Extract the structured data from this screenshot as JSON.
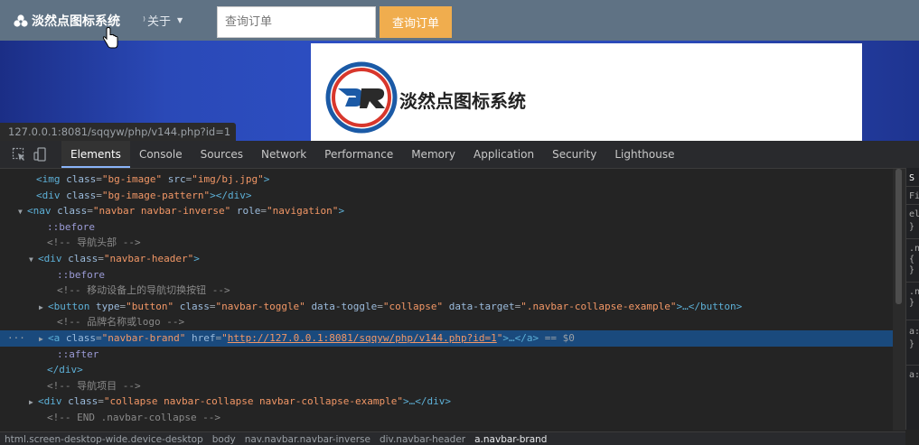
{
  "page": {
    "brand": "淡然点图标系统",
    "about_label": "关于",
    "search_placeholder": "查询订单",
    "search_button": "查询订单",
    "card_title": "淡然点图标系统",
    "status_url": "127.0.0.1:8081/sqqyw/php/v144.php?id=1"
  },
  "devtools": {
    "tabs": [
      "Elements",
      "Console",
      "Sources",
      "Network",
      "Performance",
      "Memory",
      "Application",
      "Security",
      "Lighthouse"
    ],
    "active_tab": "Elements",
    "lines": [
      {
        "t": "<img ",
        "a1": "class",
        "v1": "\"bg-image\"",
        "a2": "src",
        "v2": "\"img/bj.jpg\"",
        "e": ">"
      },
      {
        "t": "<div ",
        "a1": "class",
        "v1": "\"bg-image-pattern\"",
        "e": "></div>"
      },
      {
        "t": "<nav ",
        "a1": "class",
        "v1": "\"navbar navbar-inverse\"",
        "a2": "role",
        "v2": "\"navigation\"",
        "e": ">"
      },
      {
        "ps": "::before"
      },
      {
        "cm": "<!-- 导航头部 -->"
      },
      {
        "t": "<div ",
        "a1": "class",
        "v1": "\"navbar-header\"",
        "e": ">"
      },
      {
        "ps": "::before"
      },
      {
        "cm": "<!-- 移动设备上的导航切换按钮 -->"
      },
      {
        "t": "<button ",
        "a1": "type",
        "v1": "\"button\"",
        "a2": "class",
        "v2": "\"navbar-toggle\"",
        "a3": "data-toggle",
        "v3": "\"collapse\"",
        "a4": "data-target",
        "v4": "\".navbar-collapse-example\"",
        "e": ">…</button>"
      },
      {
        "cm": "<!-- 品牌名称或logo -->"
      },
      {
        "t": "<a ",
        "a1": "class",
        "v1": "\"navbar-brand\"",
        "a2": "href",
        "v2": "http://127.0.0.1:8081/sqqyw/php/v144.php?id=1",
        "e": ">…</a>",
        "s": " == $0"
      },
      {
        "ps": "::after"
      },
      {
        "t": "</div>"
      },
      {
        "cm": "<!-- 导航项目 -->"
      },
      {
        "t": "<div ",
        "a1": "class",
        "v1": "\"collapse navbar-collapse navbar-collapse-example\"",
        "e": ">…</div>"
      },
      {
        "cm": "<!-- END .navbar-collapse -->"
      }
    ],
    "breadcrumbs": [
      "html.screen-desktop-wide.device-desktop",
      "body",
      "nav.navbar.navbar-inverse",
      "div.navbar-header",
      "a.navbar-brand"
    ],
    "styles_fragments": [
      "S",
      "Fi",
      "el",
      "}",
      ".n",
      "{",
      "}",
      ".n",
      "}",
      "a:",
      "}",
      "a:"
    ]
  }
}
